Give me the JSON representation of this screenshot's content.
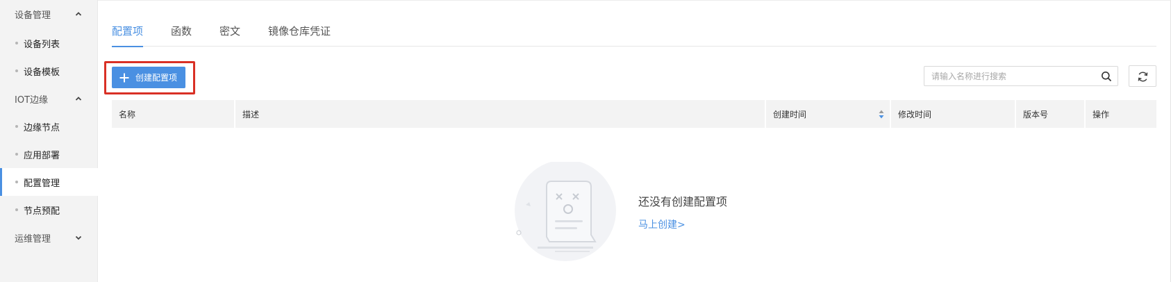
{
  "sidebar": {
    "groups": [
      {
        "label": "设备管理",
        "expanded": true,
        "items": [
          {
            "label": "设备列表"
          },
          {
            "label": "设备模板"
          }
        ]
      },
      {
        "label": "IOT边缘",
        "expanded": true,
        "items": [
          {
            "label": "边缘节点"
          },
          {
            "label": "应用部署"
          },
          {
            "label": "配置管理",
            "active": true
          },
          {
            "label": "节点预配"
          }
        ]
      },
      {
        "label": "运维管理",
        "expanded": false,
        "items": []
      }
    ]
  },
  "tabs": [
    {
      "label": "配置项",
      "active": true
    },
    {
      "label": "函数"
    },
    {
      "label": "密文"
    },
    {
      "label": "镜像仓库凭证"
    }
  ],
  "toolbar": {
    "create_label": "创建配置项",
    "search_placeholder": "请输入名称进行搜索"
  },
  "table": {
    "columns": [
      "名称",
      "描述",
      "创建时间",
      "修改时间",
      "版本号",
      "操作"
    ],
    "rows": []
  },
  "empty": {
    "title": "还没有创建配置项",
    "action": "马上创建>"
  },
  "colors": {
    "accent": "#4a90e2",
    "highlight_border": "#d93025",
    "sidebar_bg": "#f3f3f3",
    "header_bg": "#f3f3f3"
  },
  "icons": {
    "group_expanded": "chevron-up-icon",
    "group_collapsed": "chevron-down-icon",
    "create": "plus-icon",
    "search": "search-icon",
    "refresh": "refresh-icon",
    "sort": "sort-icon",
    "empty": "empty-state-illustration"
  }
}
